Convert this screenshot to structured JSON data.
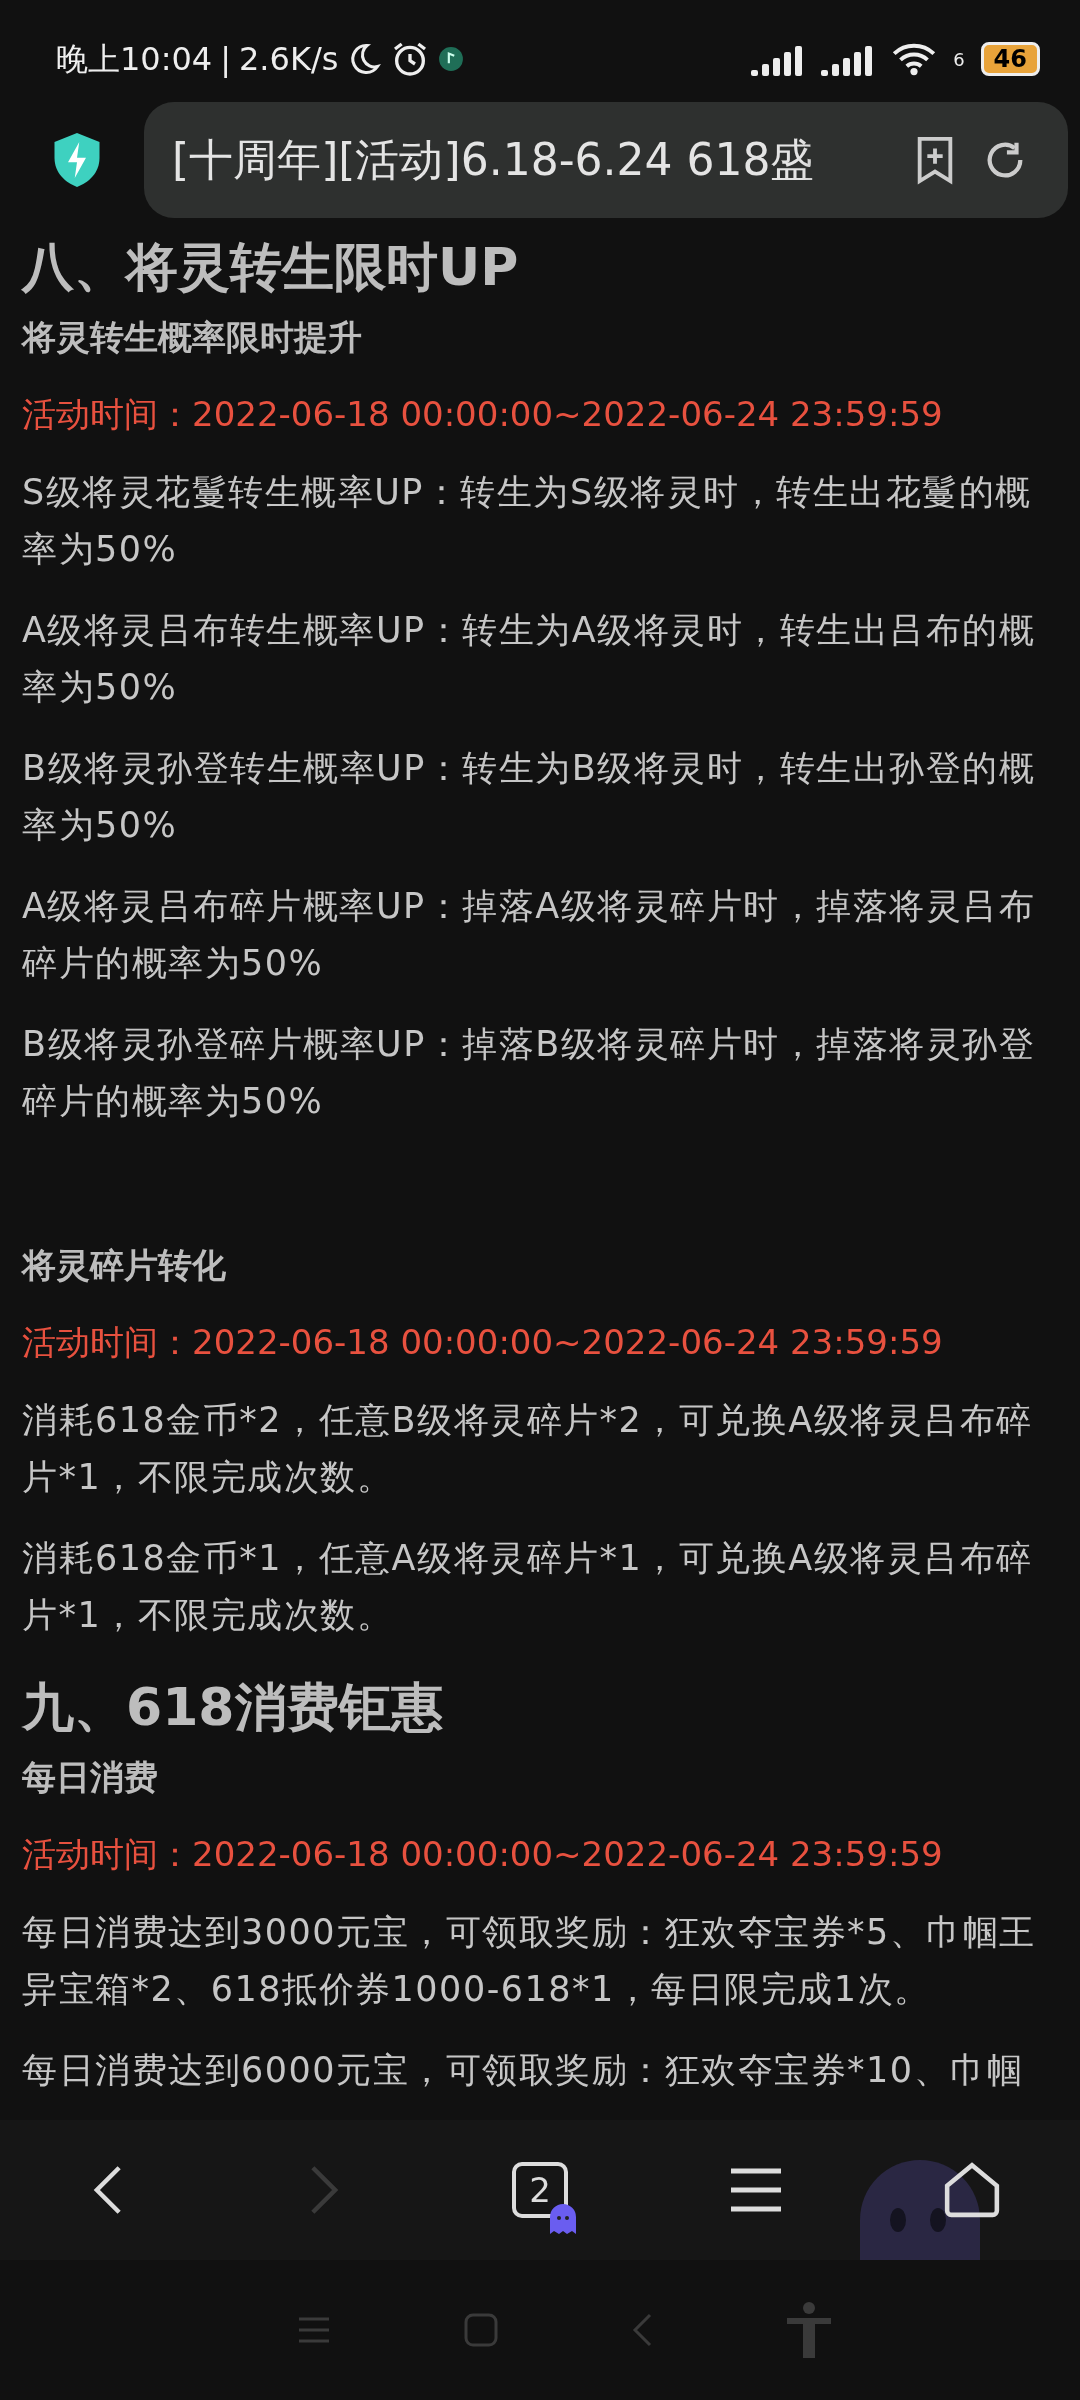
{
  "status_bar": {
    "time": "晚上10:04",
    "separator": "|",
    "speed": "2.6K/s",
    "wifi_label": "6",
    "battery": "46"
  },
  "address_bar": {
    "title": "[十周年][活动]6.18-6.24 618盛"
  },
  "sections": [
    {
      "heading": "八、将灵转生限时UP",
      "subsections": [
        {
          "title": "将灵转生概率限时提升",
          "time": "活动时间：2022-06-18 00:00:00~2022-06-24 23:59:59",
          "paragraphs": [
            "S级将灵花鬘转生概率UP：转生为S级将灵时，转生出花鬘的概率为50%",
            "A级将灵吕布转生概率UP：转生为A级将灵时，转生出吕布的概率为50%",
            "B级将灵孙登转生概率UP：转生为B级将灵时，转生出孙登的概率为50%",
            "A级将灵吕布碎片概率UP：掉落A级将灵碎片时，掉落将灵吕布碎片的概率为50%",
            "B级将灵孙登碎片概率UP：掉落B级将灵碎片时，掉落将灵孙登碎片的概率为50%"
          ]
        },
        {
          "title": "将灵碎片转化",
          "time": "活动时间：2022-06-18 00:00:00~2022-06-24 23:59:59",
          "paragraphs": [
            "消耗618金币*2，任意B级将灵碎片*2，可兑换A级将灵吕布碎片*1，不限完成次数。",
            "消耗618金币*1，任意A级将灵碎片*1，可兑换A级将灵吕布碎片*1，不限完成次数。"
          ]
        }
      ]
    },
    {
      "heading": "九、618消费钜惠",
      "subsections": [
        {
          "title": "每日消费",
          "time": "活动时间：2022-06-18 00:00:00~2022-06-24 23:59:59",
          "paragraphs": [
            "每日消费达到3000元宝，可领取奖励：狂欢夺宝券*5、巾帼王异宝箱*2、618抵价券1000-618*1，每日限完成1次。",
            "每日消费达到6000元宝，可领取奖励：狂欢夺宝券*10、巾帼"
          ]
        }
      ]
    }
  ],
  "toolbar": [
    {
      "kind": "back",
      "disabled": false
    },
    {
      "kind": "forward",
      "disabled": true
    },
    {
      "kind": "tabs",
      "label": "2",
      "disabled": false
    },
    {
      "kind": "menu",
      "disabled": false
    },
    {
      "kind": "home",
      "disabled": false
    }
  ]
}
